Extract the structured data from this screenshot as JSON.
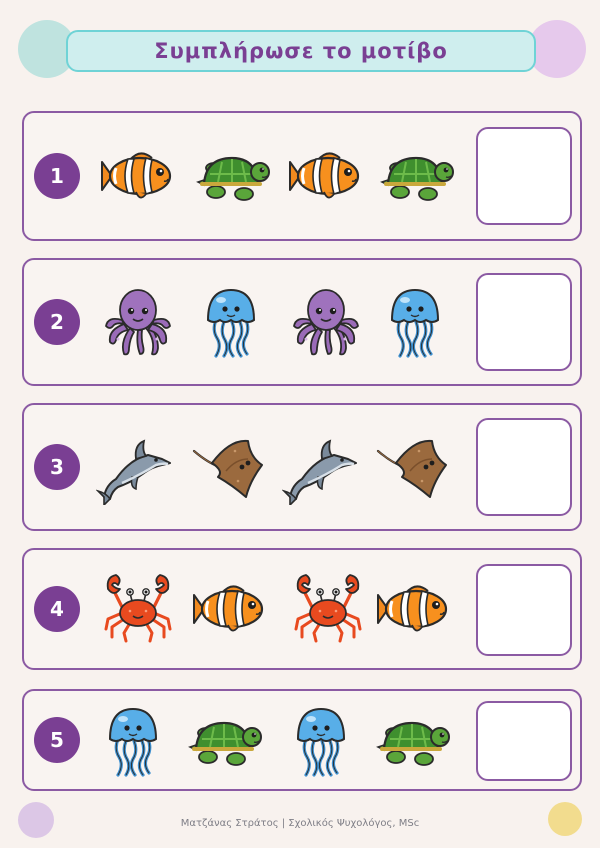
{
  "title": "Συμπλήρωσε το μοτίβο",
  "rows": [
    {
      "number": "1",
      "pattern": [
        "clownfish",
        "turtle",
        "clownfish",
        "turtle"
      ]
    },
    {
      "number": "2",
      "pattern": [
        "octopus",
        "jellyfish",
        "octopus",
        "jellyfish"
      ]
    },
    {
      "number": "3",
      "pattern": [
        "dolphin",
        "stingray",
        "dolphin",
        "stingray"
      ]
    },
    {
      "number": "4",
      "pattern": [
        "crab",
        "clownfish",
        "crab",
        "clownfish"
      ]
    },
    {
      "number": "5",
      "pattern": [
        "jellyfish",
        "turtle",
        "jellyfish",
        "turtle"
      ]
    }
  ],
  "footer": "Ματζάνας Στράτος | Σχολικός Ψυχολόγος, MSc",
  "colors": {
    "accent": "#7a3f93",
    "row_border": "#8b5aa3",
    "title_bg": "#cfeeee",
    "title_border": "#6fd3d6",
    "page_bg": "#f8f2ee"
  }
}
